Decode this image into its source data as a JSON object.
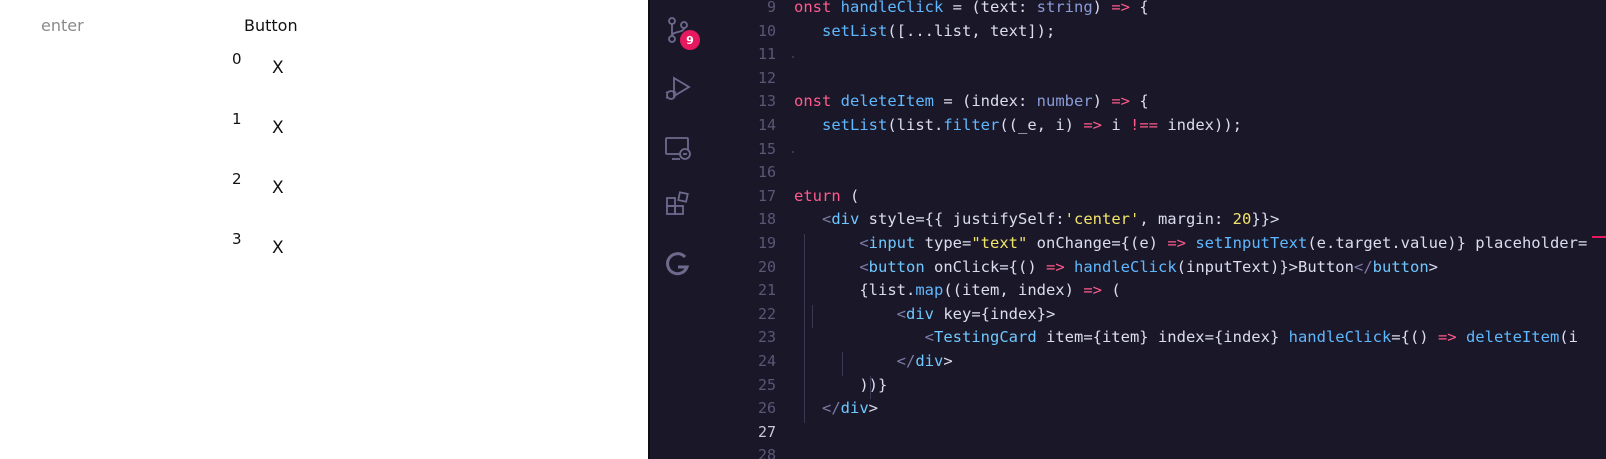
{
  "preview": {
    "input_placeholder": "enter",
    "button_label": "Button",
    "items": [
      {
        "index": "0",
        "delete_label": "X"
      },
      {
        "index": "1",
        "delete_label": "X"
      },
      {
        "index": "2",
        "delete_label": "X"
      },
      {
        "index": "3",
        "delete_label": "X"
      }
    ]
  },
  "editor": {
    "activity_bar": {
      "items": [
        {
          "icon": "source-control-icon",
          "badge": "9"
        },
        {
          "icon": "run-debug-icon"
        },
        {
          "icon": "remote-explorer-icon"
        },
        {
          "icon": "extensions-icon"
        },
        {
          "icon": "gitlens-icon"
        }
      ]
    },
    "line_numbers": [
      "9",
      "10",
      "11",
      "12",
      "13",
      "14",
      "15",
      "16",
      "17",
      "18",
      "19",
      "20",
      "21",
      "22",
      "23",
      "24",
      "25",
      "26",
      "27",
      "28"
    ],
    "active_line": "27",
    "code_lines": [
      "onst handleClick = (text: string) => {",
      "   setList([...list, text]);",
      "",
      "",
      "onst deleteItem = (index: number) => {",
      "   setList(list.filter((_e, i) => i !== index));",
      "",
      "",
      "eturn (",
      "   <div style={{ justifySelf:'center', margin: 20}}>",
      "       <input type=\"text\" onChange={(e) => setInputText(e.target.value)} placeholder=",
      "       <button onClick={() => handleClick(inputText)}>Button</button>",
      "       {list.map((item, index) => (",
      "           <div key={index}>",
      "              <TestingCard item={item} index={index} handleClick={() => deleteItem(i",
      "           </div>",
      "       ))}",
      "   </div>",
      "",
      ""
    ]
  },
  "colors": {
    "editor_bg": "#1a1828",
    "keyword": "#ff5a8c",
    "function": "#5fb8ff",
    "string": "#f2e36b",
    "badge": "#e6195f"
  }
}
